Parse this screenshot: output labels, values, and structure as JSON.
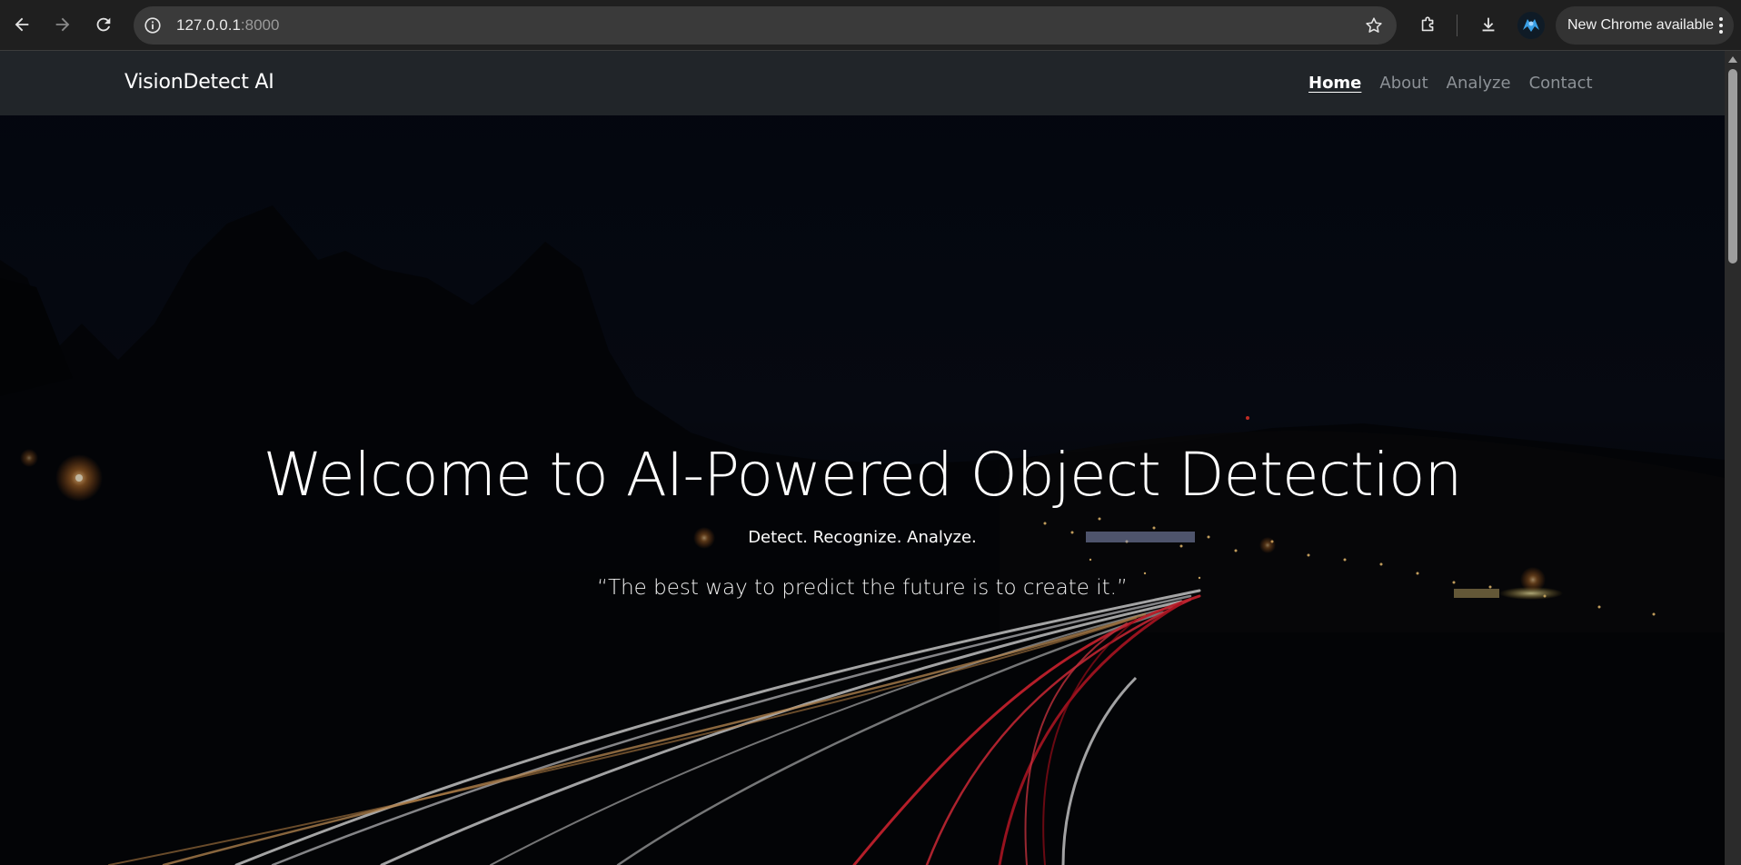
{
  "browser": {
    "url_host": "127.0.0.1",
    "url_port": ":8000",
    "update_label": "New Chrome available",
    "icons": {
      "back": "back-arrow-icon",
      "forward": "forward-arrow-icon",
      "reload": "reload-icon",
      "site_info": "info-icon",
      "bookmark": "star-icon",
      "extensions": "puzzle-icon",
      "downloads": "download-icon",
      "profile": "avatar",
      "menu": "kebab-menu-icon"
    }
  },
  "navbar": {
    "brand": "VisionDetect AI",
    "links": [
      {
        "label": "Home",
        "active": true
      },
      {
        "label": "About",
        "active": false
      },
      {
        "label": "Analyze",
        "active": false
      },
      {
        "label": "Contact",
        "active": false
      }
    ]
  },
  "hero": {
    "title": "Welcome to AI-Powered Object Detection",
    "tagline": "Detect. Recognize. Analyze.",
    "quote": "“The best way to predict the future is to create it.”"
  },
  "colors": {
    "navbar_bg": "#212529",
    "chrome_toolbar": "#1f1f1f",
    "omnibox": "#3a3a3a",
    "light_trail_red": "#ff2b3a",
    "light_trail_white": "#f3f3f3"
  }
}
